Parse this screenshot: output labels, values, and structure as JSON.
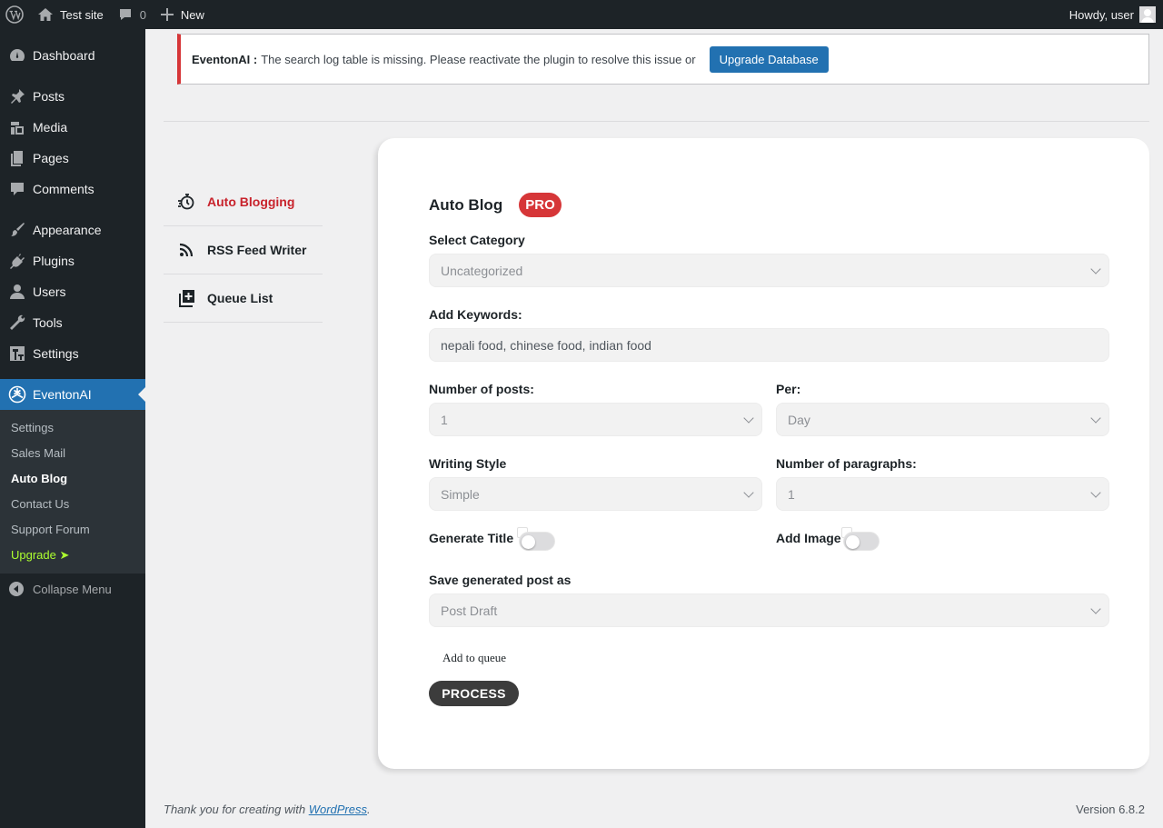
{
  "admin_bar": {
    "site_name": "Test site",
    "comments_count": "0",
    "new_label": "New",
    "greeting": "Howdy, user"
  },
  "sidebar": {
    "items": [
      {
        "label": "Dashboard",
        "icon": "dashboard-icon"
      },
      {
        "label": "Posts",
        "icon": "pin-icon"
      },
      {
        "label": "Media",
        "icon": "media-icon"
      },
      {
        "label": "Pages",
        "icon": "pages-icon"
      },
      {
        "label": "Comments",
        "icon": "comment-icon"
      },
      {
        "label": "Appearance",
        "icon": "brush-icon"
      },
      {
        "label": "Plugins",
        "icon": "plug-icon"
      },
      {
        "label": "Users",
        "icon": "user-icon"
      },
      {
        "label": "Tools",
        "icon": "wrench-icon"
      },
      {
        "label": "Settings",
        "icon": "settings-icon"
      },
      {
        "label": "EventonAI",
        "icon": "openai-icon"
      }
    ],
    "submenu": [
      "Settings",
      "Sales Mail",
      "Auto Blog",
      "Contact Us",
      "Support Forum",
      "Upgrade ➤"
    ],
    "collapse_label": "Collapse Menu"
  },
  "notice": {
    "plugin": "EventonAI :",
    "message": "The search log table is missing. Please reactivate the plugin to resolve this issue or",
    "button": "Upgrade Database",
    "accent": "#d63638"
  },
  "tabs": [
    "Auto Blogging",
    "RSS Feed Writer",
    "Queue List"
  ],
  "form": {
    "title": "Auto Blog",
    "badge": "PRO",
    "category_label": "Select Category",
    "category_value": "Uncategorized",
    "keywords_label": "Add Keywords:",
    "keywords_value": "nepali food, chinese food, indian food",
    "posts_label": "Number of posts:",
    "posts_value": "1",
    "per_label": "Per:",
    "per_value": "Day",
    "style_label": "Writing Style",
    "style_value": "Simple",
    "paragraphs_label": "Number of paragraphs:",
    "paragraphs_value": "1",
    "generate_title_label": "Generate Title",
    "generate_title_on": false,
    "add_image_label": "Add Image",
    "add_image_on": false,
    "save_as_label": "Save generated post as",
    "save_as_value": "Post Draft",
    "queue_label": "Add to queue",
    "process_button": "PROCESS"
  },
  "footer": {
    "thanks_prefix": "Thank you for creating with",
    "link": "WordPress",
    "suffix": ".",
    "version": "Version 6.8.2"
  },
  "colors": {
    "admin_bg": "#1d2327",
    "primary": "#2271b1",
    "active_tab": "#c8232c",
    "upgrade": "#adff2f"
  }
}
